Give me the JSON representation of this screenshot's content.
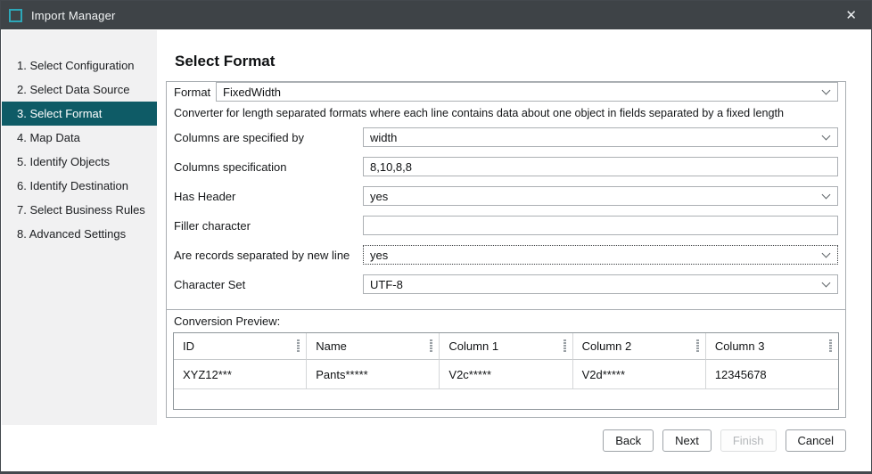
{
  "window": {
    "title": "Import Manager",
    "icons": {
      "close": "✕"
    }
  },
  "colors": {
    "titlebar_bg": "#3e4347",
    "accent_teal": "#2da7b8",
    "sidebar_selected_bg": "#0e5b66"
  },
  "sidebar": {
    "selected_index": 2,
    "items": [
      "1. Select Configuration",
      "2. Select Data Source",
      "3. Select Format",
      "4. Map Data",
      "5. Identify Objects",
      "6. Identify Destination",
      "7. Select Business Rules",
      "8. Advanced Settings"
    ]
  },
  "main": {
    "title": "Select Format",
    "format": {
      "label": "Format",
      "value": "FixedWidth"
    },
    "description": "Converter for length separated formats where each line contains data about one object in fields separated by a fixed length",
    "fields": [
      {
        "label": "Columns are specified by",
        "value": "width",
        "type": "select"
      },
      {
        "label": "Columns specification",
        "value": "8,10,8,8",
        "type": "text"
      },
      {
        "label": "Has Header",
        "value": "yes",
        "type": "select"
      },
      {
        "label": "Filler character",
        "value": "",
        "type": "text"
      },
      {
        "label": "Are records separated by new line",
        "value": "yes",
        "type": "select",
        "focused": true
      },
      {
        "label": "Character Set",
        "value": "UTF-8",
        "type": "select"
      }
    ],
    "preview": {
      "label": "Conversion Preview:",
      "columns": [
        "ID",
        "Name",
        "Column 1",
        "Column 2",
        "Column 3"
      ],
      "row": [
        "XYZ12***",
        "Pants*****",
        "V2c*****",
        "V2d*****",
        "12345678"
      ]
    }
  },
  "footer": {
    "back": "Back",
    "next": "Next",
    "finish": "Finish",
    "cancel": "Cancel"
  }
}
